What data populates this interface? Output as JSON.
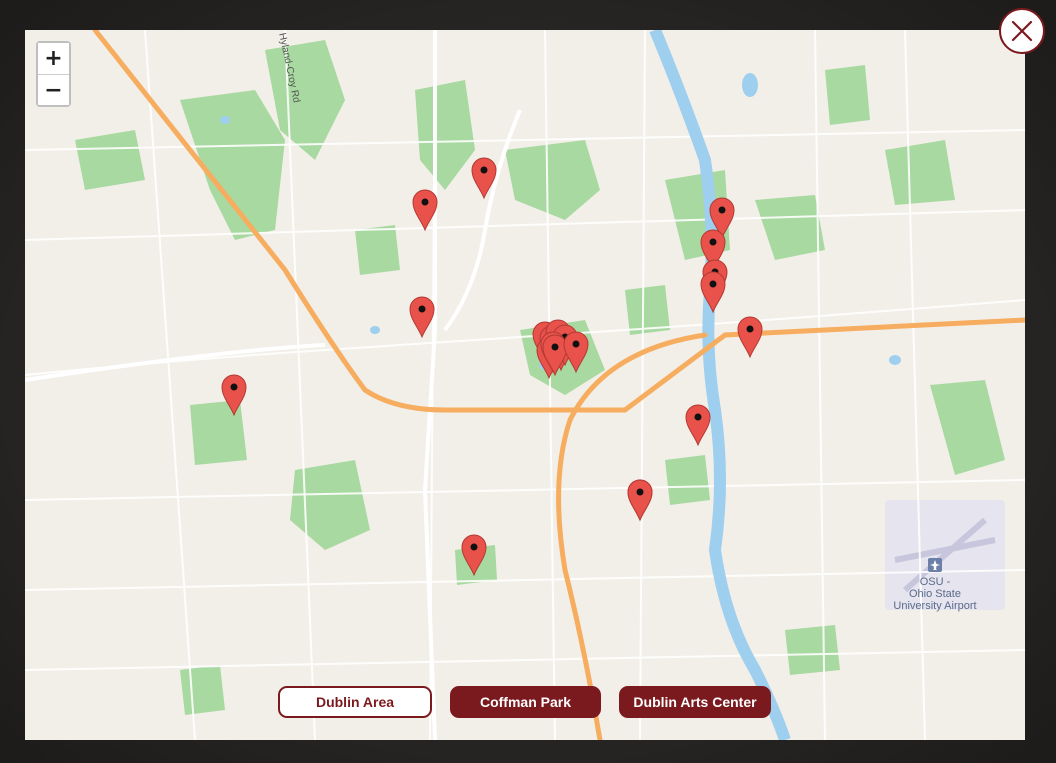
{
  "map": {
    "zoom_in": "+",
    "zoom_out": "−",
    "road_label": "Hyland-Croy Rd",
    "airport_label_line1": "OSU -",
    "airport_label_line2": "Ohio State",
    "airport_label_line3": "University Airport",
    "airport_icon": "airplane-icon",
    "marker_icon": "map-pin-icon",
    "marker_color": "#e8524a",
    "marker_count": 22
  },
  "tabs": [
    {
      "label": "Dublin Area",
      "active": false
    },
    {
      "label": "Coffman Park",
      "active": true
    },
    {
      "label": "Dublin Arts Center",
      "active": true
    }
  ],
  "close": {
    "icon": "close-icon"
  },
  "colors": {
    "brand": "#7b1a1e",
    "park": "#9fd49a",
    "water": "#9ecfee",
    "highway": "#f6ad5f",
    "land": "#f2efe9"
  }
}
